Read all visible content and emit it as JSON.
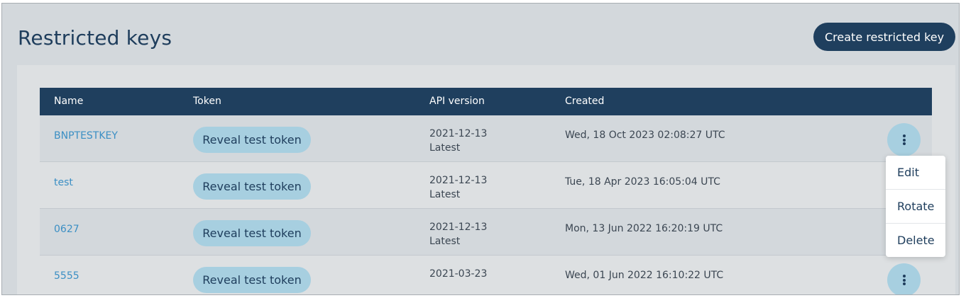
{
  "page": {
    "title": "Restricted keys",
    "create_button_label": "Create restricted key"
  },
  "table": {
    "headers": {
      "name": "Name",
      "token": "Token",
      "api_version": "API version",
      "created": "Created"
    },
    "rows": [
      {
        "name": "BNPTESTKEY",
        "token_button": "Reveal test token",
        "api_version": "2021-12-13",
        "api_version_note": "Latest",
        "created": "Wed, 18 Oct 2023 02:08:27 UTC"
      },
      {
        "name": "test",
        "token_button": "Reveal test token",
        "api_version": "2021-12-13",
        "api_version_note": "Latest",
        "created": "Tue, 18 Apr 2023 16:05:04 UTC"
      },
      {
        "name": "0627",
        "token_button": "Reveal test token",
        "api_version": "2021-12-13",
        "api_version_note": "Latest",
        "created": "Mon, 13 Jun 2022 16:20:19 UTC"
      },
      {
        "name": "5555",
        "token_button": "Reveal test token",
        "api_version": "2021-03-23",
        "api_version_note": "",
        "created": "Wed, 01 Jun 2022 16:10:22 UTC"
      }
    ]
  },
  "row_menu": {
    "items": [
      {
        "label": "Edit"
      },
      {
        "label": "Rotate"
      },
      {
        "label": "Delete"
      }
    ]
  },
  "colors": {
    "primary_dark": "#1f3f5e",
    "accent_light": "#a7cfe0",
    "link": "#3b8fc4",
    "background": "#d3d8dc"
  },
  "icons": {
    "row_actions": "kebab-menu-icon"
  }
}
